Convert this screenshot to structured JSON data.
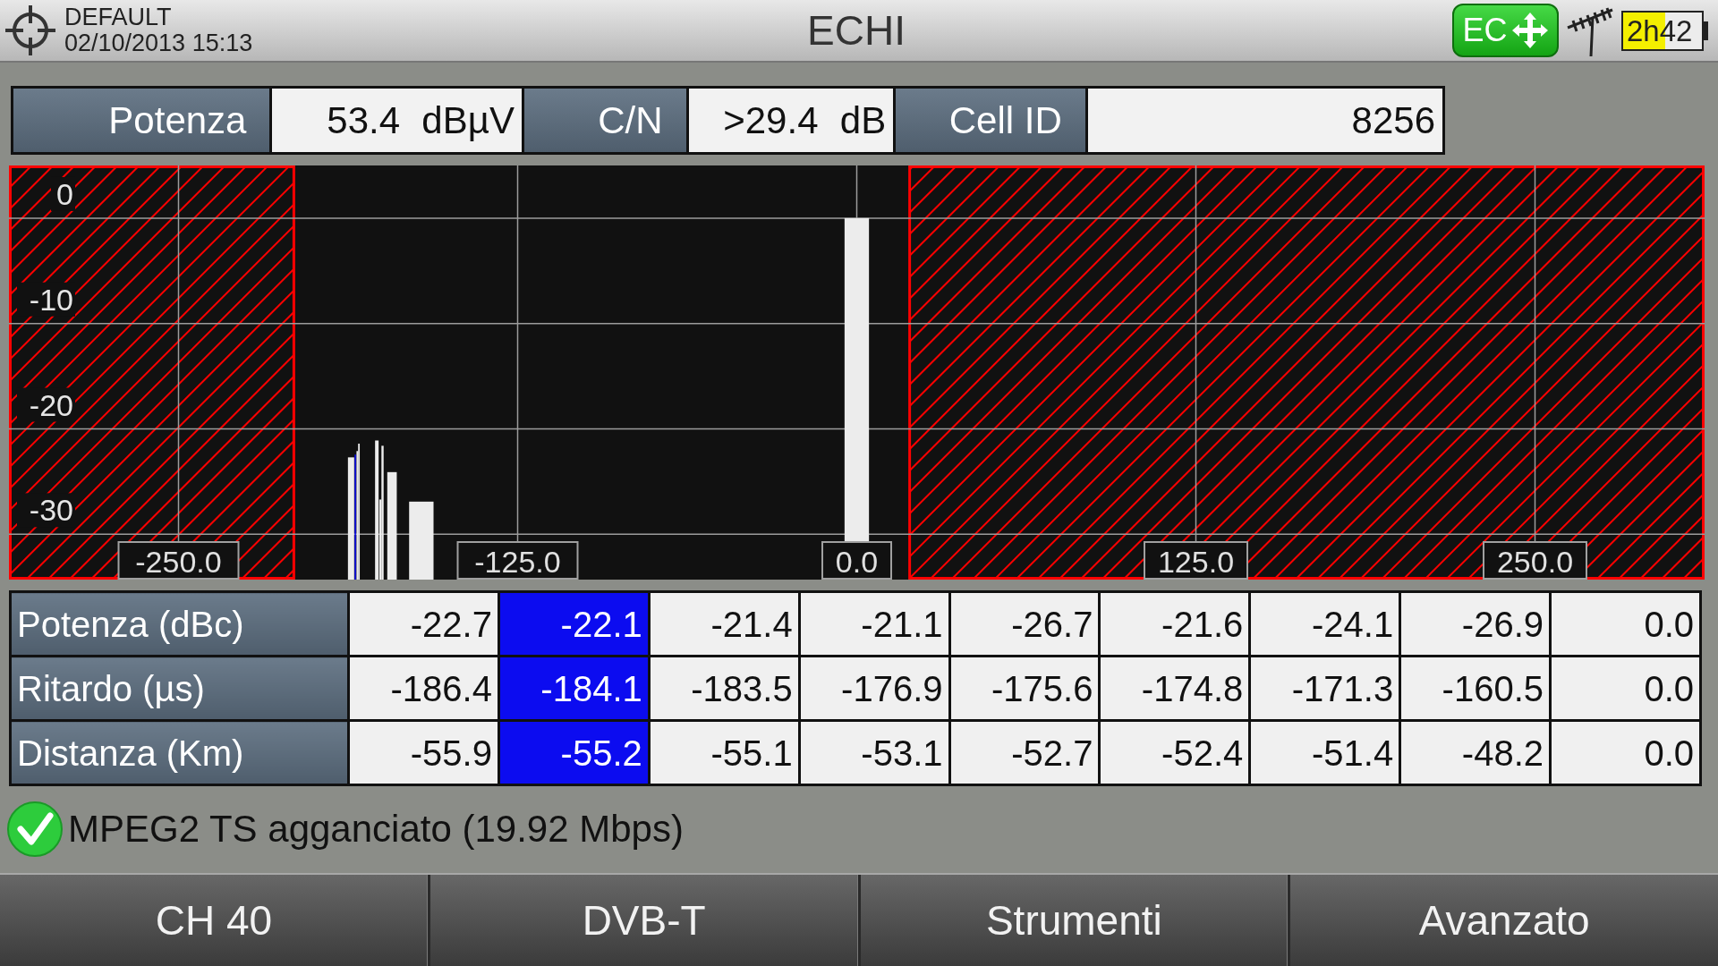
{
  "header": {
    "profile": "DEFAULT",
    "datetime": "02/10/2013 15:13",
    "title": "ECHI",
    "mode_badge": "EC",
    "battery_time": "2h42"
  },
  "measurements": [
    {
      "label": "Potenza",
      "value": "53.4 dBµV"
    },
    {
      "label": "C/N",
      "value": ">29.4 dB"
    },
    {
      "label": "Cell ID",
      "value": "8256"
    }
  ],
  "echo_chart": {
    "chart_data": [
      {
        "type": "bar",
        "x": [
          -186.4,
          -184.1,
          -183.5,
          -176.9,
          -175.6,
          -174.8,
          -171.3,
          -160.5,
          0.0
        ],
        "base": [
          -34.3,
          -34.3,
          -34.3,
          -34.3,
          -34.3,
          -34.3,
          -34.3,
          -34.3,
          -34.3
        ],
        "values": [
          11.6,
          12.2,
          12.9,
          13.2,
          7.6,
          12.7,
          10.2,
          7.4,
          34.3
        ],
        "color": "#ececec",
        "xlim": [
          -312.5,
          312.5
        ],
        "ylim": [
          -34.3,
          5
        ],
        "xticks": [
          {
            "value": -250,
            "label": "-250.0"
          },
          {
            "value": -125,
            "label": "-125.0"
          },
          {
            "value": 0,
            "label": "0.0"
          },
          {
            "value": 125,
            "label": "125.0"
          },
          {
            "value": 250,
            "label": "250.0"
          }
        ],
        "yticks": [
          0,
          -10,
          -20,
          -30
        ],
        "grid": true,
        "bands": [
          {
            "axis": "x",
            "from": -312.5,
            "to": -207,
            "color": "#ff0000"
          },
          {
            "axis": "x",
            "from": 19,
            "to": 312.5,
            "color": "#ff0000"
          }
        ]
      }
    ]
  },
  "echo_table": {
    "columns": [
      {
        "selected": false
      },
      {
        "selected": true
      },
      {
        "selected": false
      },
      {
        "selected": false
      },
      {
        "selected": false
      },
      {
        "selected": false
      },
      {
        "selected": false
      },
      {
        "selected": false
      },
      {
        "selected": false
      }
    ],
    "rows": [
      {
        "label": "Potenza (dBc)",
        "cells": [
          "-22.7",
          "-22.1",
          "-21.4",
          "-21.1",
          "-26.7",
          "-21.6",
          "-24.1",
          "-26.9",
          "0.0"
        ]
      },
      {
        "label": "Ritardo (µs)",
        "cells": [
          "-186.4",
          "-184.1",
          "-183.5",
          "-176.9",
          "-175.6",
          "-174.8",
          "-171.3",
          "-160.5",
          "0.0"
        ]
      },
      {
        "label": "Distanza (Km)",
        "cells": [
          "-55.9",
          "-55.2",
          "-55.1",
          "-53.1",
          "-52.7",
          "-52.4",
          "-51.4",
          "-48.2",
          "0.0"
        ]
      }
    ]
  },
  "status": {
    "locked": true,
    "text": "MPEG2 TS agganciato (19.92 Mbps)"
  },
  "softkeys": [
    "CH 40",
    "DVB-T",
    "Strumenti",
    "Avanzato"
  ]
}
